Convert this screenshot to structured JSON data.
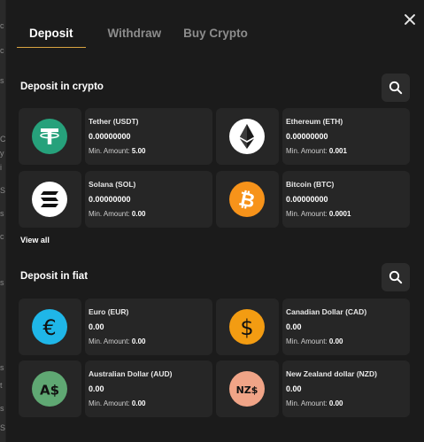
{
  "tabs": [
    {
      "label": "Deposit",
      "active": true
    },
    {
      "label": "Withdraw",
      "active": false
    },
    {
      "label": "Buy Crypto",
      "active": false
    }
  ],
  "crypto": {
    "title": "Deposit in crypto",
    "items": [
      {
        "name": "Tether (USDT)",
        "balance": "0.00000000",
        "min_label": "Min. Amount:",
        "min_value": "5.00",
        "icon": "tether-icon",
        "color": "#26a17b"
      },
      {
        "name": "Ethereum (ETH)",
        "balance": "0.00000000",
        "min_label": "Min. Amount:",
        "min_value": "0.001",
        "icon": "ethereum-icon",
        "color": "#ffffff"
      },
      {
        "name": "Solana (SOL)",
        "balance": "0.00000000",
        "min_label": "Min. Amount:",
        "min_value": "0.00",
        "icon": "solana-icon",
        "color": "#ffffff"
      },
      {
        "name": "Bitcoin (BTC)",
        "balance": "0.00000000",
        "min_label": "Min. Amount:",
        "min_value": "0.0001",
        "icon": "bitcoin-icon",
        "color": "#f7931a"
      }
    ],
    "view_all": "View all"
  },
  "fiat": {
    "title": "Deposit in fiat",
    "items": [
      {
        "name": "Euro (EUR)",
        "balance": "0.00",
        "min_label": "Min. Amount:",
        "min_value": "0.00",
        "icon": "euro-icon",
        "glyph": "€",
        "color": "#1fb6e8"
      },
      {
        "name": "Canadian Dollar (CAD)",
        "balance": "0.00",
        "min_label": "Min. Amount:",
        "min_value": "0.00",
        "icon": "dollar-icon",
        "glyph": "$",
        "color": "#f39c12"
      },
      {
        "name": "Australian Dollar (AUD)",
        "balance": "0.00",
        "min_label": "Min. Amount:",
        "min_value": "0.00",
        "icon": "aud-icon",
        "glyph": "A$",
        "color": "#5fa873"
      },
      {
        "name": "New Zealand dollar (NZD)",
        "balance": "0.00",
        "min_label": "Min. Amount:",
        "min_value": "0.00",
        "icon": "nzd-icon",
        "glyph": "NZ$",
        "color": "#f0a487"
      }
    ]
  },
  "background_text": [
    "c",
    "c",
    "s",
    "C",
    "y",
    "i",
    "S",
    "s",
    "c",
    "s",
    "s",
    "t",
    "s",
    "S"
  ]
}
